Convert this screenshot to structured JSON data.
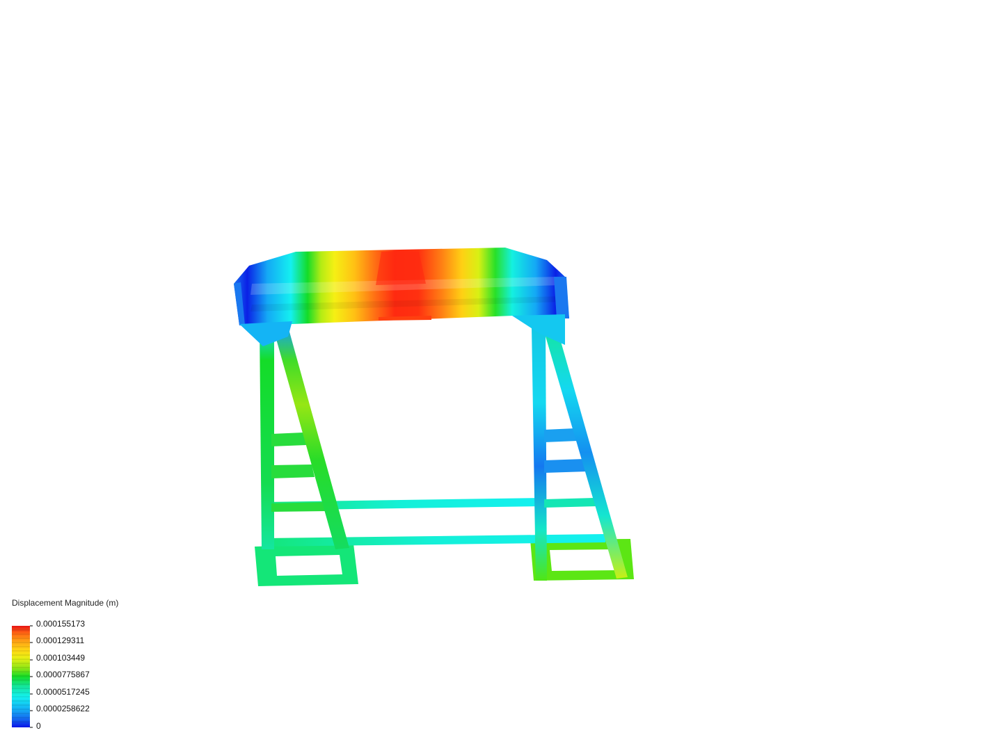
{
  "legend": {
    "title": "Displacement Magnitude (m)",
    "ticks": [
      "0.000155173",
      "0.000129311",
      "0.000103449",
      "0.0000775867",
      "0.0000517245",
      "0.0000258622",
      "0"
    ],
    "colormap": [
      "#0a14e6",
      "#1466f0",
      "#14aaf5",
      "#14f0f0",
      "#14e6a0",
      "#14dc28",
      "#8ce614",
      "#e6f014",
      "#ffd714",
      "#ffa014",
      "#ff6414",
      "#ff2814",
      "#dc1414"
    ]
  },
  "model": {
    "description_icon": "displacement-contour-model"
  }
}
